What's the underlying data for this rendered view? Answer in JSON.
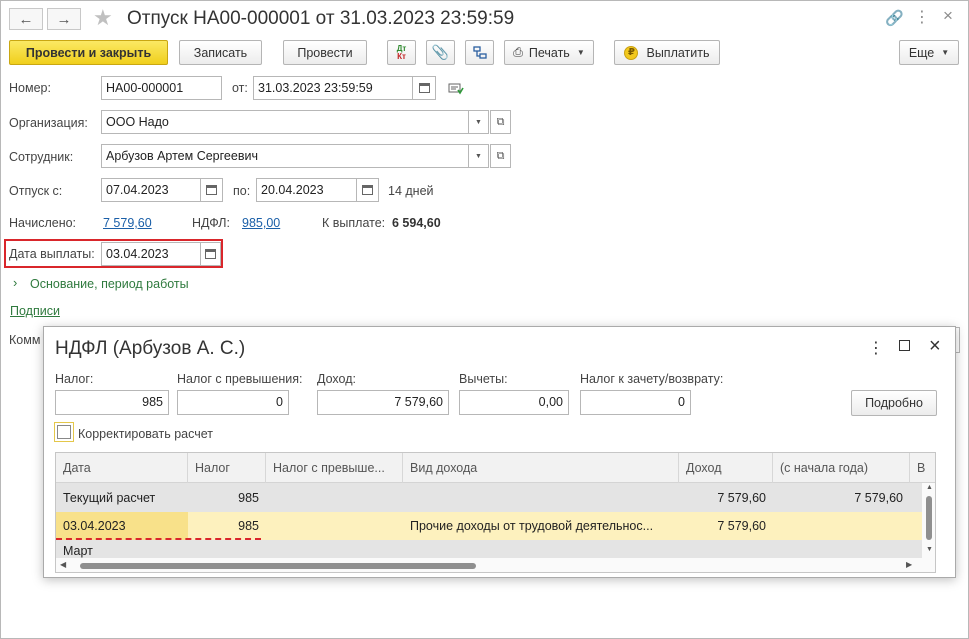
{
  "window": {
    "title": "Отпуск НА00-000001 от 31.03.2023 23:59:59"
  },
  "toolbar": {
    "post_close": "Провести и закрыть",
    "save": "Записать",
    "post": "Провести",
    "dtkt_top": "Дт",
    "dtkt_bottom": "Кт",
    "print": "Печать",
    "pay": "Выплатить",
    "more": "Еще"
  },
  "form": {
    "number_label": "Номер:",
    "number_value": "НА00-000001",
    "from_label": "от:",
    "from_value": "31.03.2023 23:59:59",
    "org_label": "Организация:",
    "org_value": "ООО Надо",
    "employee_label": "Сотрудник:",
    "employee_value": "Арбузов Артем Сергеевич",
    "vacation_from_label": "Отпуск с:",
    "vacation_from_value": "07.04.2023",
    "vacation_to_label": "по:",
    "vacation_to_value": "20.04.2023",
    "days": "14 дней",
    "accrued_label": "Начислено:",
    "accrued_value": "7 579,60",
    "ndfl_label": "НДФЛ:",
    "ndfl_value": "985,00",
    "to_pay_label": "К выплате:",
    "to_pay_value": "6 594,60",
    "pay_date_label": "Дата выплаты:",
    "pay_date_value": "03.04.2023",
    "basis_link": "Основание, период работы",
    "signatures_link": "Подписи",
    "comment_label_partial": "Комм"
  },
  "dialog": {
    "title": "НДФЛ (Арбузов А. С.)",
    "tax_label": "Налог:",
    "tax_value": "985",
    "tax_excess_label": "Налог с превышения:",
    "tax_excess_value": "0",
    "income_label": "Доход:",
    "income_value": "7 579,60",
    "deductions_label": "Вычеты:",
    "deductions_value": "0,00",
    "offset_label": "Налог к зачету/возврату:",
    "offset_value": "0",
    "details_button": "Подробно",
    "correct_checkbox": "Корректировать расчет",
    "table": {
      "headers": [
        "Дата",
        "Налог",
        "Налог с превыше...",
        "Вид дохода",
        "Доход",
        "(с начала года)",
        "В"
      ],
      "rows": [
        [
          "Текущий расчет",
          "985",
          "",
          "",
          "7 579,60",
          "7 579,60"
        ],
        [
          "03.04.2023",
          "985",
          "",
          "Прочие доходы от трудовой деятельнос...",
          "7 579,60",
          ""
        ],
        [
          "Март",
          "",
          "",
          "",
          "",
          ""
        ]
      ]
    }
  },
  "colors": {
    "primary_button": "#f0cf1c",
    "highlight_frame": "#d9262b",
    "selected_row": "#fdf1be",
    "link": "#1a5fa8",
    "green_link": "#2f7a3e"
  }
}
